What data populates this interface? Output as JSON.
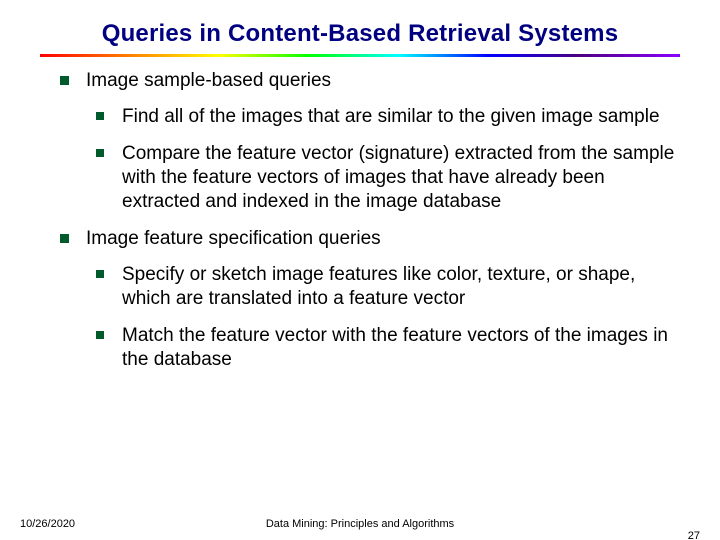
{
  "title": "Queries in Content-Based Retrieval Systems",
  "section1": {
    "heading": "Image sample-based queries",
    "items": [
      "Find all of the images that are similar to the given image sample",
      "Compare the feature vector (signature) extracted from the sample with the feature vectors of images that have already been extracted and indexed in the image database"
    ]
  },
  "section2": {
    "heading": "Image feature specification queries",
    "items": [
      "Specify or sketch image features like color, texture, or shape, which are translated into a feature vector",
      "Match the feature vector with the feature vectors of the images in the database"
    ]
  },
  "footer": {
    "date": "10/26/2020",
    "center": "Data Mining: Principles and Algorithms",
    "page": "27"
  }
}
